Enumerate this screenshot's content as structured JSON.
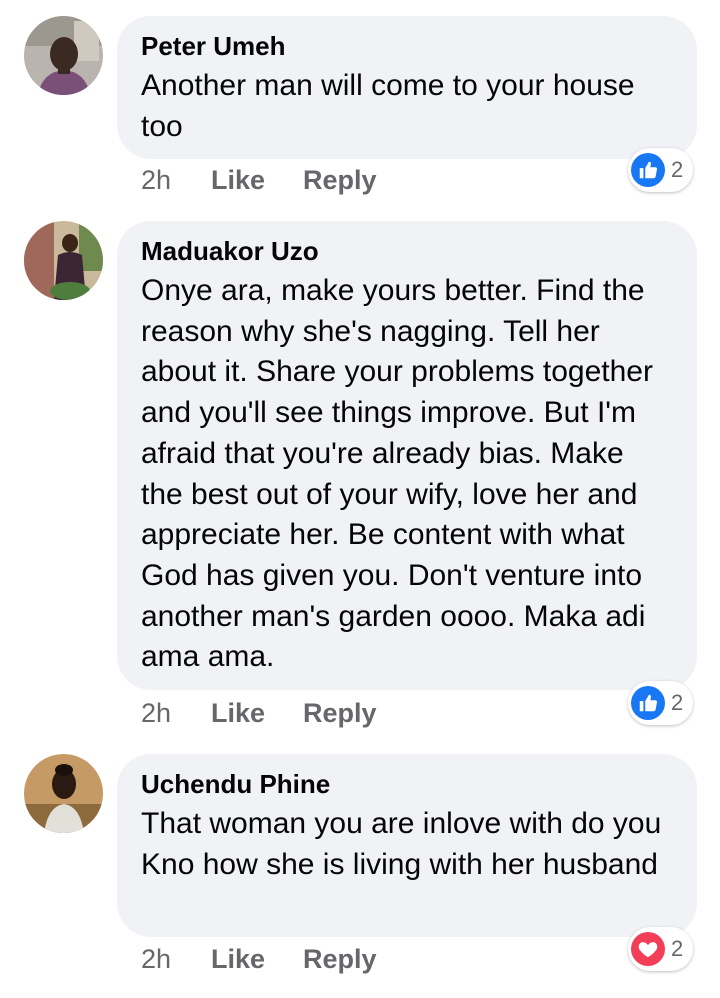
{
  "comments": [
    {
      "author": "Peter Umeh",
      "text": "Another man will come to your house too",
      "time": "2h",
      "like_label": "Like",
      "reply_label": "Reply",
      "reaction_icon": "like-icon",
      "reaction_color": "#1877f2",
      "reaction_count": "2"
    },
    {
      "author": "Maduakor Uzo",
      "text": "Onye ara, make yours better. Find the reason why she's nagging. Tell her about it. Share your problems together and you'll see things improve. But I'm afraid that you're already bias. Make the best out of your wify, love her and appreciate her. Be content with what God has given you. Don't venture into another man's garden oooo. Maka adi ama ama.",
      "time": "2h",
      "like_label": "Like",
      "reply_label": "Reply",
      "reaction_icon": "like-icon",
      "reaction_color": "#1877f2",
      "reaction_count": "2"
    },
    {
      "author": "Uchendu Phine",
      "text": "That woman you are inlove with do you Kno how she is living with her husband",
      "time": "2h",
      "like_label": "Like",
      "reply_label": "Reply",
      "reaction_icon": "love-icon",
      "reaction_color": "#f33e58",
      "reaction_count": "2"
    }
  ]
}
